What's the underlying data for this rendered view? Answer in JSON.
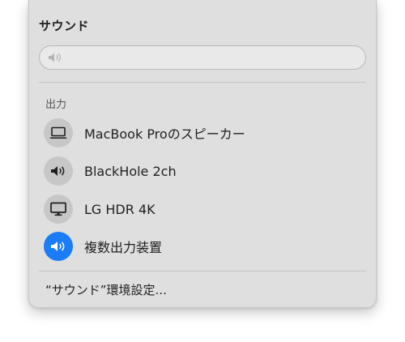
{
  "menu": {
    "title": "サウンド",
    "volume_fraction": 0.0
  },
  "output": {
    "section_label": "出力",
    "devices": [
      {
        "label": "MacBook Proのスピーカー",
        "icon": "laptop-icon",
        "selected": false
      },
      {
        "label": "BlackHole 2ch",
        "icon": "speaker-icon",
        "selected": false
      },
      {
        "label": "LG HDR 4K",
        "icon": "display-icon",
        "selected": false
      },
      {
        "label": "複数出力装置",
        "icon": "speaker-icon",
        "selected": true
      }
    ]
  },
  "footer": {
    "settings_label": "“サウンド”環境設定..."
  },
  "colors": {
    "selected_accent": "#1a7cf6",
    "icon_circle": "#c7c7c7",
    "panel_bg": "#dfdfdf"
  }
}
